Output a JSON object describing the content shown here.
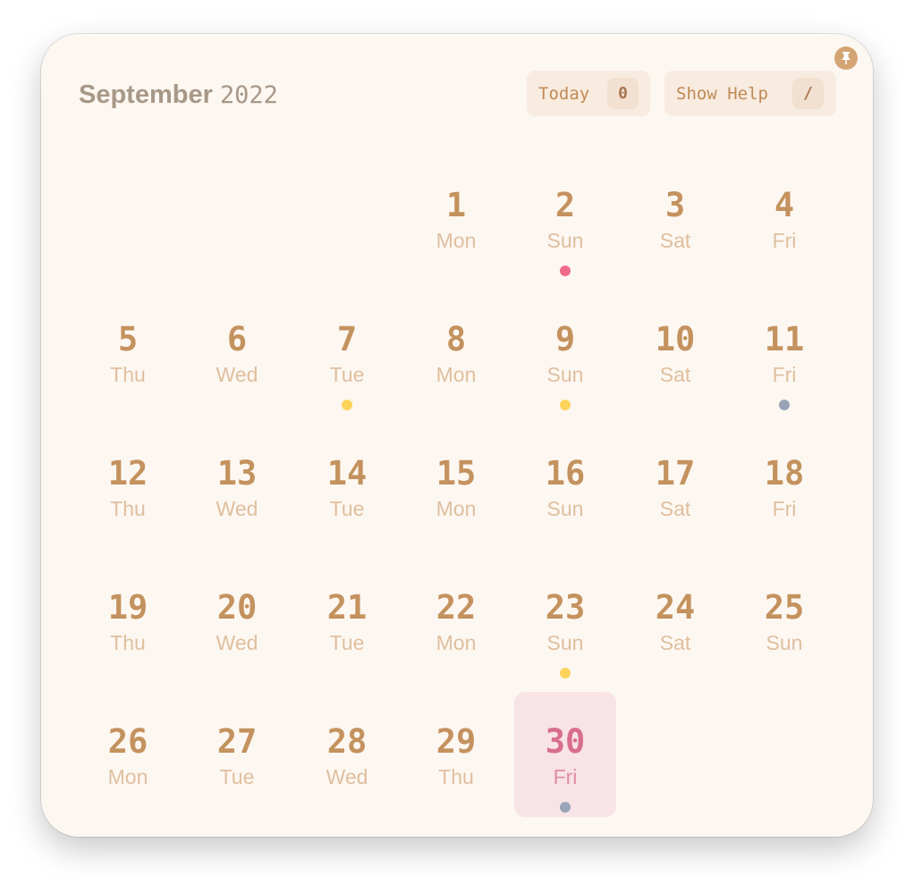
{
  "header": {
    "month": "September",
    "year": "2022"
  },
  "buttons": {
    "today_label": "Today",
    "today_key": "0",
    "help_label": "Show Help",
    "help_key": "/"
  },
  "pin_icon": "pin-icon",
  "colors": {
    "background": "#fdf7f1",
    "day_number": "#c4925e",
    "weekday": "#dfbf9f",
    "today_bg": "#f8e3e6",
    "today_text": "#d86e8c",
    "dot_pink": "#f06a8a",
    "dot_yellow": "#fcd35b",
    "dot_gray": "#9aa4b8"
  },
  "days": [
    {
      "day": "1",
      "weekday": "Mon"
    },
    {
      "day": "2",
      "weekday": "Sun",
      "dot": "pink"
    },
    {
      "day": "3",
      "weekday": "Sat"
    },
    {
      "day": "4",
      "weekday": "Fri"
    },
    {
      "day": "5",
      "weekday": "Thu"
    },
    {
      "day": "6",
      "weekday": "Wed"
    },
    {
      "day": "7",
      "weekday": "Tue",
      "dot": "yellow"
    },
    {
      "day": "8",
      "weekday": "Mon"
    },
    {
      "day": "9",
      "weekday": "Sun",
      "dot": "yellow"
    },
    {
      "day": "10",
      "weekday": "Sat"
    },
    {
      "day": "11",
      "weekday": "Fri",
      "dot": "gray"
    },
    {
      "day": "12",
      "weekday": "Thu"
    },
    {
      "day": "13",
      "weekday": "Wed"
    },
    {
      "day": "14",
      "weekday": "Tue"
    },
    {
      "day": "15",
      "weekday": "Mon"
    },
    {
      "day": "16",
      "weekday": "Sun"
    },
    {
      "day": "17",
      "weekday": "Sat"
    },
    {
      "day": "18",
      "weekday": "Fri"
    },
    {
      "day": "19",
      "weekday": "Thu"
    },
    {
      "day": "20",
      "weekday": "Wed"
    },
    {
      "day": "21",
      "weekday": "Tue"
    },
    {
      "day": "22",
      "weekday": "Mon"
    },
    {
      "day": "23",
      "weekday": "Sun",
      "dot": "yellow"
    },
    {
      "day": "24",
      "weekday": "Sat"
    },
    {
      "day": "25",
      "weekday": "Sun"
    },
    {
      "day": "26",
      "weekday": "Mon"
    },
    {
      "day": "27",
      "weekday": "Tue"
    },
    {
      "day": "28",
      "weekday": "Wed"
    },
    {
      "day": "29",
      "weekday": "Thu"
    },
    {
      "day": "30",
      "weekday": "Fri",
      "dot": "gray",
      "today": true
    }
  ]
}
